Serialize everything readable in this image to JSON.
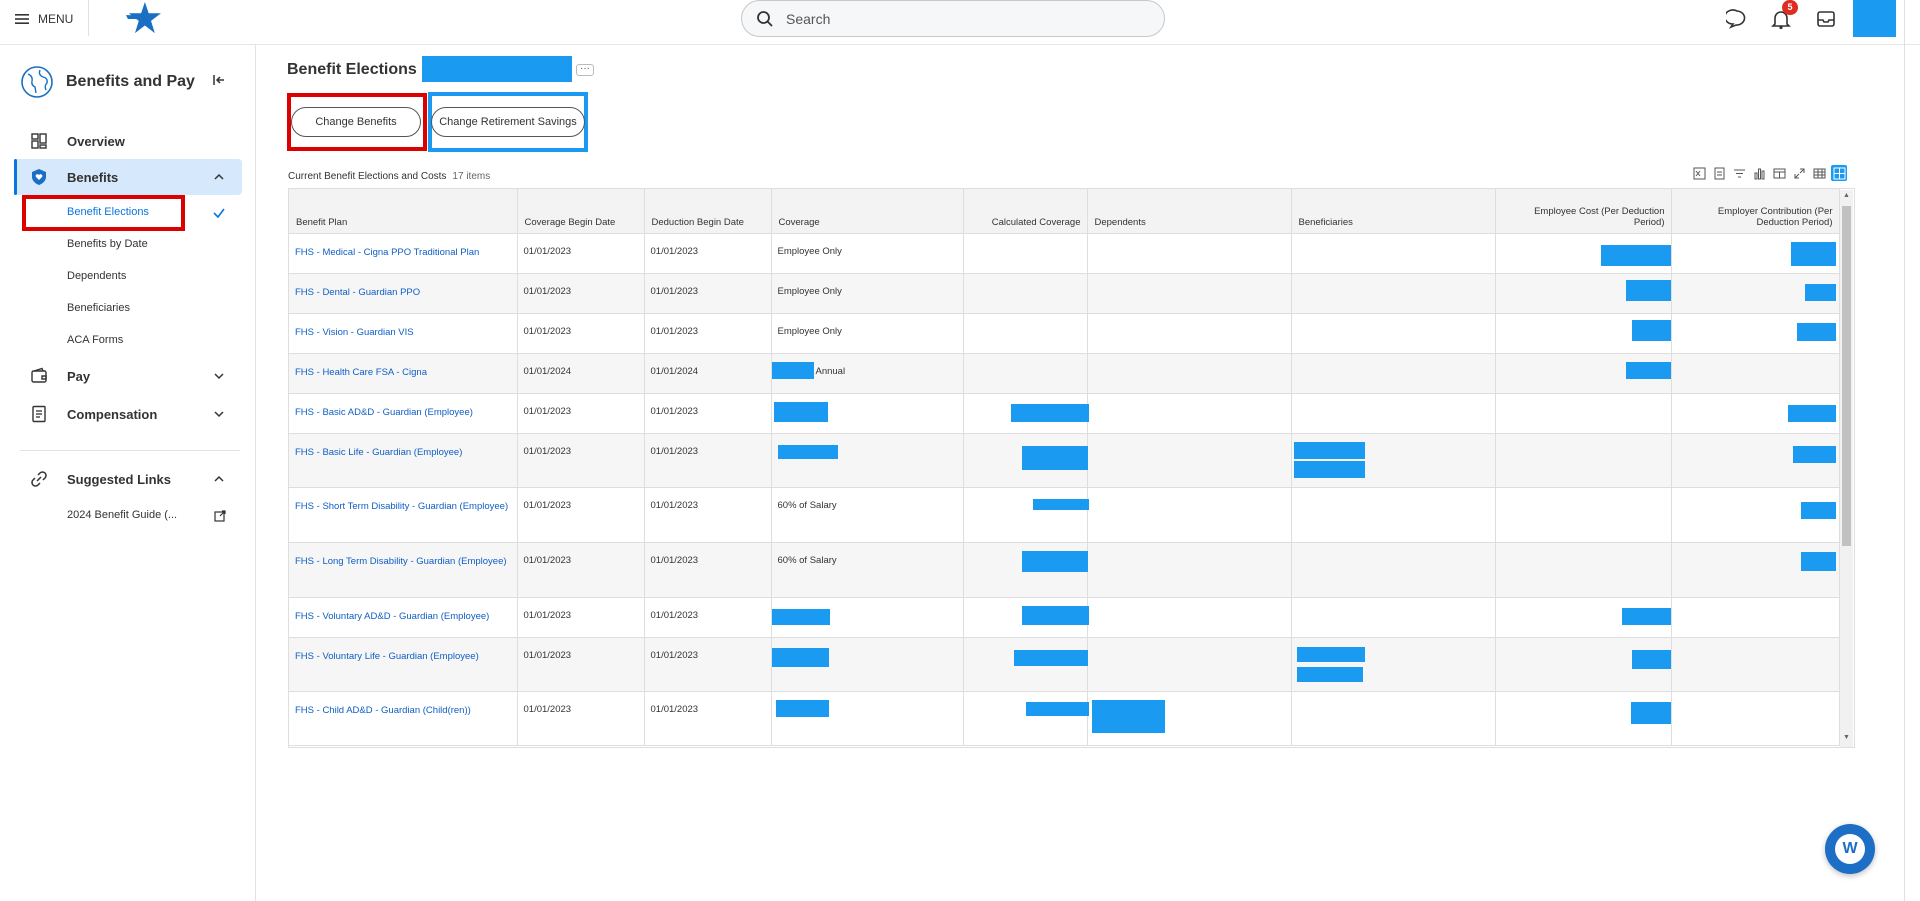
{
  "topbar": {
    "menu_label": "MENU",
    "search_placeholder": "Search",
    "notification_count": "5"
  },
  "sidebar": {
    "title": "Benefits and Pay",
    "items": [
      {
        "label": "Overview"
      },
      {
        "label": "Benefits"
      },
      {
        "label": "Pay"
      },
      {
        "label": "Compensation"
      }
    ],
    "benefits_sub": [
      "Benefit Elections",
      "Benefits by Date",
      "Dependents",
      "Beneficiaries",
      "ACA Forms"
    ],
    "suggested_title": "Suggested Links",
    "suggested_links": [
      "2024 Benefit Guide (..."
    ]
  },
  "main": {
    "page_title": "Benefit Elections",
    "change_benefits": "Change Benefits",
    "change_retirement": "Change Retirement Savings",
    "table_title": "Current Benefit Elections and Costs",
    "table_count": "17 items",
    "columns": [
      "Benefit Plan",
      "Coverage Begin Date",
      "Deduction Begin Date",
      "Coverage",
      "Calculated Coverage",
      "Dependents",
      "Beneficiaries",
      "Employee Cost (Per Deduction Period)",
      "Employer Contribution (Per Deduction Period)"
    ],
    "rows": [
      {
        "plan": "FHS - Medical - Cigna PPO Traditional Plan",
        "cov_begin": "01/01/2023",
        "ded_begin": "01/01/2023",
        "coverage": "Employee Only"
      },
      {
        "plan": "FHS - Dental - Guardian PPO",
        "cov_begin": "01/01/2023",
        "ded_begin": "01/01/2023",
        "coverage": "Employee Only"
      },
      {
        "plan": "FHS - Vision - Guardian VIS",
        "cov_begin": "01/01/2023",
        "ded_begin": "01/01/2023",
        "coverage": "Employee Only"
      },
      {
        "plan": "FHS - Health Care FSA - Cigna",
        "cov_begin": "01/01/2024",
        "ded_begin": "01/01/2024",
        "coverage": "Annual"
      },
      {
        "plan": "FHS - Basic AD&D - Guardian (Employee)",
        "cov_begin": "01/01/2023",
        "ded_begin": "01/01/2023",
        "coverage": ""
      },
      {
        "plan": "FHS - Basic Life - Guardian (Employee)",
        "cov_begin": "01/01/2023",
        "ded_begin": "01/01/2023",
        "coverage": ""
      },
      {
        "plan": "FHS - Short Term Disability - Guardian (Employee)",
        "cov_begin": "01/01/2023",
        "ded_begin": "01/01/2023",
        "coverage": "60% of Salary"
      },
      {
        "plan": "FHS - Long Term Disability - Guardian (Employee)",
        "cov_begin": "01/01/2023",
        "ded_begin": "01/01/2023",
        "coverage": "60% of Salary"
      },
      {
        "plan": "FHS - Voluntary AD&D - Guardian (Employee)",
        "cov_begin": "01/01/2023",
        "ded_begin": "01/01/2023",
        "coverage": ""
      },
      {
        "plan": "FHS - Voluntary Life - Guardian (Employee)",
        "cov_begin": "01/01/2023",
        "ded_begin": "01/01/2023",
        "coverage": ""
      },
      {
        "plan": "FHS - Child AD&D - Guardian (Child(ren))",
        "cov_begin": "01/01/2023",
        "ded_begin": "01/01/2023",
        "coverage": ""
      }
    ]
  },
  "colors": {
    "accent": "#0875e1",
    "redaction": "#1a9af0",
    "highlight_red": "#dc0000",
    "link": "#0f5ec4"
  }
}
